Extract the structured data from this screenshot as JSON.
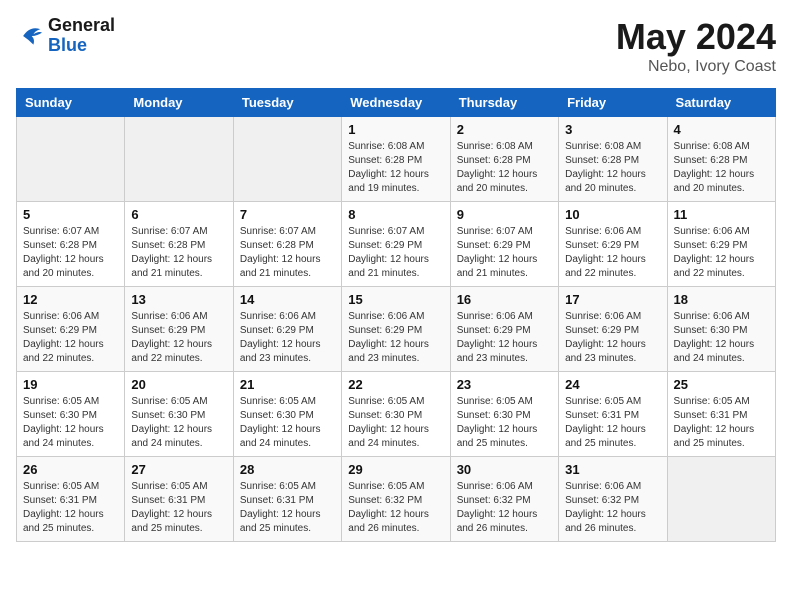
{
  "logo": {
    "line1": "General",
    "line2": "Blue"
  },
  "title": {
    "month": "May 2024",
    "location": "Nebo, Ivory Coast"
  },
  "weekdays": [
    "Sunday",
    "Monday",
    "Tuesday",
    "Wednesday",
    "Thursday",
    "Friday",
    "Saturday"
  ],
  "weeks": [
    [
      {
        "day": "",
        "info": ""
      },
      {
        "day": "",
        "info": ""
      },
      {
        "day": "",
        "info": ""
      },
      {
        "day": "1",
        "info": "Sunrise: 6:08 AM\nSunset: 6:28 PM\nDaylight: 12 hours\nand 19 minutes."
      },
      {
        "day": "2",
        "info": "Sunrise: 6:08 AM\nSunset: 6:28 PM\nDaylight: 12 hours\nand 20 minutes."
      },
      {
        "day": "3",
        "info": "Sunrise: 6:08 AM\nSunset: 6:28 PM\nDaylight: 12 hours\nand 20 minutes."
      },
      {
        "day": "4",
        "info": "Sunrise: 6:08 AM\nSunset: 6:28 PM\nDaylight: 12 hours\nand 20 minutes."
      }
    ],
    [
      {
        "day": "5",
        "info": "Sunrise: 6:07 AM\nSunset: 6:28 PM\nDaylight: 12 hours\nand 20 minutes."
      },
      {
        "day": "6",
        "info": "Sunrise: 6:07 AM\nSunset: 6:28 PM\nDaylight: 12 hours\nand 21 minutes."
      },
      {
        "day": "7",
        "info": "Sunrise: 6:07 AM\nSunset: 6:28 PM\nDaylight: 12 hours\nand 21 minutes."
      },
      {
        "day": "8",
        "info": "Sunrise: 6:07 AM\nSunset: 6:29 PM\nDaylight: 12 hours\nand 21 minutes."
      },
      {
        "day": "9",
        "info": "Sunrise: 6:07 AM\nSunset: 6:29 PM\nDaylight: 12 hours\nand 21 minutes."
      },
      {
        "day": "10",
        "info": "Sunrise: 6:06 AM\nSunset: 6:29 PM\nDaylight: 12 hours\nand 22 minutes."
      },
      {
        "day": "11",
        "info": "Sunrise: 6:06 AM\nSunset: 6:29 PM\nDaylight: 12 hours\nand 22 minutes."
      }
    ],
    [
      {
        "day": "12",
        "info": "Sunrise: 6:06 AM\nSunset: 6:29 PM\nDaylight: 12 hours\nand 22 minutes."
      },
      {
        "day": "13",
        "info": "Sunrise: 6:06 AM\nSunset: 6:29 PM\nDaylight: 12 hours\nand 22 minutes."
      },
      {
        "day": "14",
        "info": "Sunrise: 6:06 AM\nSunset: 6:29 PM\nDaylight: 12 hours\nand 23 minutes."
      },
      {
        "day": "15",
        "info": "Sunrise: 6:06 AM\nSunset: 6:29 PM\nDaylight: 12 hours\nand 23 minutes."
      },
      {
        "day": "16",
        "info": "Sunrise: 6:06 AM\nSunset: 6:29 PM\nDaylight: 12 hours\nand 23 minutes."
      },
      {
        "day": "17",
        "info": "Sunrise: 6:06 AM\nSunset: 6:29 PM\nDaylight: 12 hours\nand 23 minutes."
      },
      {
        "day": "18",
        "info": "Sunrise: 6:06 AM\nSunset: 6:30 PM\nDaylight: 12 hours\nand 24 minutes."
      }
    ],
    [
      {
        "day": "19",
        "info": "Sunrise: 6:05 AM\nSunset: 6:30 PM\nDaylight: 12 hours\nand 24 minutes."
      },
      {
        "day": "20",
        "info": "Sunrise: 6:05 AM\nSunset: 6:30 PM\nDaylight: 12 hours\nand 24 minutes."
      },
      {
        "day": "21",
        "info": "Sunrise: 6:05 AM\nSunset: 6:30 PM\nDaylight: 12 hours\nand 24 minutes."
      },
      {
        "day": "22",
        "info": "Sunrise: 6:05 AM\nSunset: 6:30 PM\nDaylight: 12 hours\nand 24 minutes."
      },
      {
        "day": "23",
        "info": "Sunrise: 6:05 AM\nSunset: 6:30 PM\nDaylight: 12 hours\nand 25 minutes."
      },
      {
        "day": "24",
        "info": "Sunrise: 6:05 AM\nSunset: 6:31 PM\nDaylight: 12 hours\nand 25 minutes."
      },
      {
        "day": "25",
        "info": "Sunrise: 6:05 AM\nSunset: 6:31 PM\nDaylight: 12 hours\nand 25 minutes."
      }
    ],
    [
      {
        "day": "26",
        "info": "Sunrise: 6:05 AM\nSunset: 6:31 PM\nDaylight: 12 hours\nand 25 minutes."
      },
      {
        "day": "27",
        "info": "Sunrise: 6:05 AM\nSunset: 6:31 PM\nDaylight: 12 hours\nand 25 minutes."
      },
      {
        "day": "28",
        "info": "Sunrise: 6:05 AM\nSunset: 6:31 PM\nDaylight: 12 hours\nand 25 minutes."
      },
      {
        "day": "29",
        "info": "Sunrise: 6:05 AM\nSunset: 6:32 PM\nDaylight: 12 hours\nand 26 minutes."
      },
      {
        "day": "30",
        "info": "Sunrise: 6:06 AM\nSunset: 6:32 PM\nDaylight: 12 hours\nand 26 minutes."
      },
      {
        "day": "31",
        "info": "Sunrise: 6:06 AM\nSunset: 6:32 PM\nDaylight: 12 hours\nand 26 minutes."
      },
      {
        "day": "",
        "info": ""
      }
    ]
  ]
}
